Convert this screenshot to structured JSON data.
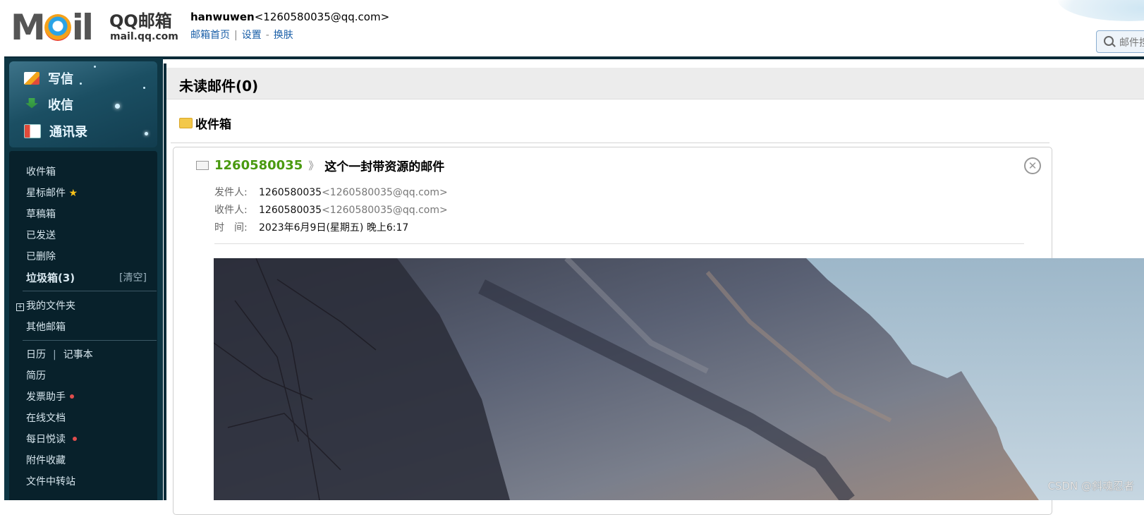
{
  "header": {
    "logo_text": "Moil",
    "brand": "QQ邮箱",
    "brand_sub": "mail.qq.com",
    "account_name": "hanwuwen",
    "account_email": "<1260580035@qq.com>",
    "links": [
      "邮箱首页",
      "设置",
      "换肤"
    ],
    "search_placeholder": "邮件搜索"
  },
  "nav": {
    "compose": "写信",
    "receive": "收信",
    "contacts": "通讯录"
  },
  "folders": {
    "inbox": "收件箱",
    "starred": "星标邮件",
    "drafts": "草稿箱",
    "sent": "已发送",
    "deleted": "已删除",
    "spam": "垃圾箱(3)",
    "spam_clear": "[清空]",
    "my_folders": "我的文件夹",
    "other_mail": "其他邮箱",
    "calendar": "日历",
    "notes": "记事本",
    "resume": "简历",
    "invoice": "发票助手",
    "docs": "在线文档",
    "daily_read": "每日悦读",
    "attachments": "附件收藏",
    "transfer": "文件中转站"
  },
  "main": {
    "unread_title": "未读邮件(0)",
    "inbox_label": "收件箱",
    "mail": {
      "sender": "1260580035",
      "arrow": "》",
      "subject": "这个一封带资源的邮件",
      "from_label": "发件人:",
      "from_name": "1260580035",
      "from_email": "<1260580035@qq.com>",
      "to_label": "收件人:",
      "to_name": "1260580035",
      "to_email": "<1260580035@qq.com>",
      "time_label": "时　间:",
      "time_value": "2023年6月9日(星期五) 晚上6:17"
    }
  },
  "watermark": "CSDN @斜魂忍者",
  "colors": {
    "sidebar_bg": "#08212b",
    "sender_green": "#4a9a10",
    "link_blue": "#1a5fa8"
  }
}
